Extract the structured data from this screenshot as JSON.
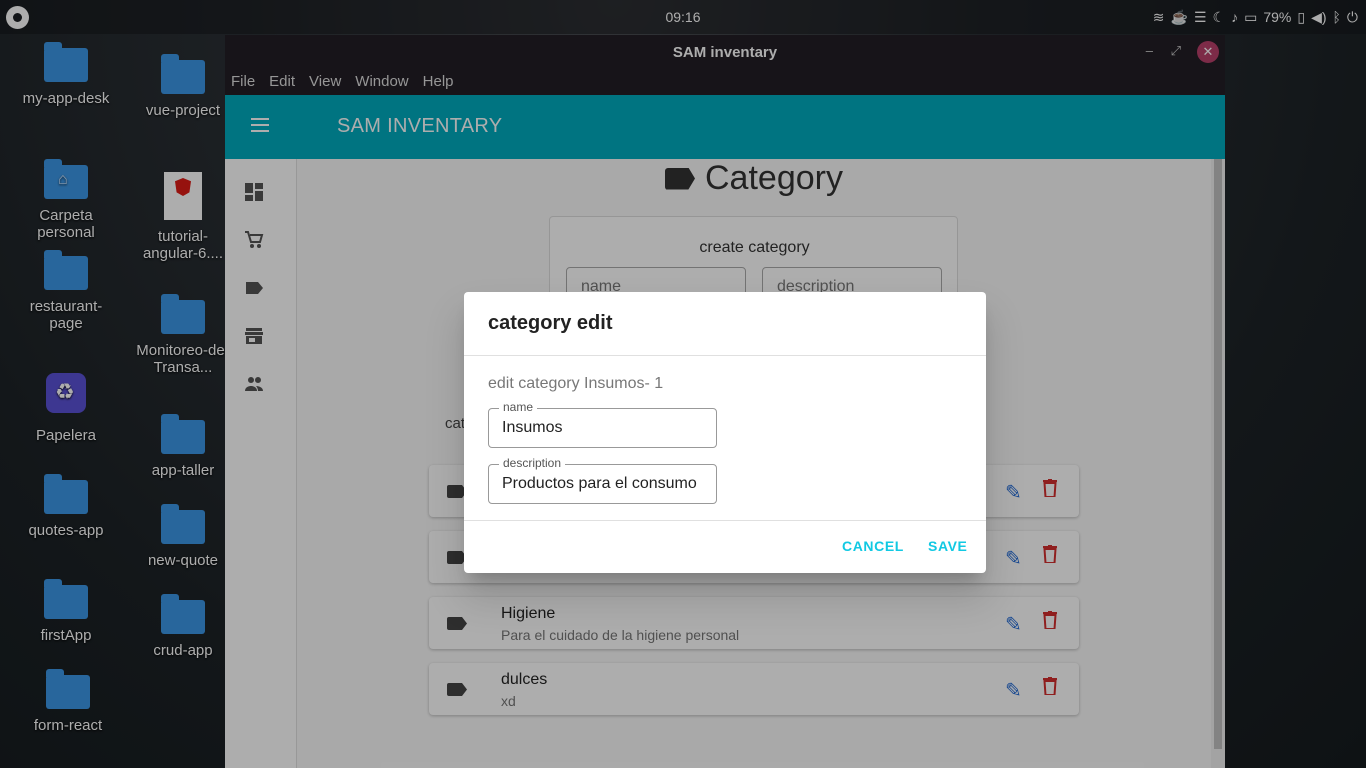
{
  "topbar": {
    "clock": "09:16",
    "battery_percent": "79%",
    "tray_icons": [
      "wifi-icon",
      "coffee-icon",
      "menu-icon",
      "moon-icon",
      "bell-icon",
      "folder-icon",
      "battery-icon",
      "volume-icon",
      "bluetooth-icon",
      "power-icon"
    ]
  },
  "desktop": {
    "icons": [
      {
        "label": "my-app-desk",
        "kind": "folder"
      },
      {
        "label": "vue-project",
        "kind": "folder"
      },
      {
        "label": "Carpeta personal",
        "kind": "home-folder"
      },
      {
        "label": "tutorial-angular-6....",
        "kind": "document"
      },
      {
        "label": "restaurant-page",
        "kind": "folder"
      },
      {
        "label": "Monitoreo-de-Transa...",
        "kind": "folder"
      },
      {
        "label": "Papelera",
        "kind": "trash"
      },
      {
        "label": "app-taller",
        "kind": "folder"
      },
      {
        "label": "quotes-app",
        "kind": "folder"
      },
      {
        "label": "new-quote",
        "kind": "folder"
      },
      {
        "label": "firstApp",
        "kind": "folder"
      },
      {
        "label": "crud-app",
        "kind": "folder"
      },
      {
        "label": "form-react",
        "kind": "folder"
      }
    ]
  },
  "window": {
    "title": "SAM inventary",
    "controls": [
      "minimize-icon",
      "maximize-icon",
      "close-icon"
    ],
    "menu": [
      "File",
      "Edit",
      "View",
      "Window",
      "Help"
    ]
  },
  "app": {
    "brand": "SAM INVENTARY",
    "accent_color": "#00abbf",
    "sidenav": [
      "dashboard-icon",
      "cart-icon",
      "label-icon",
      "store-icon",
      "people-icon"
    ],
    "page_title": "Category",
    "create_card": {
      "title": "create category",
      "name_placeholder": "name",
      "description_placeholder": "description"
    },
    "list_label_peek": "cat",
    "rows": [
      {
        "name": "",
        "description": ""
      },
      {
        "name": "",
        "description": ""
      },
      {
        "name": "Higiene",
        "description": "Para el cuidado de la higiene personal"
      },
      {
        "name": "dulces",
        "description": "xd"
      }
    ]
  },
  "dialog": {
    "title": "category edit",
    "subtitle": "edit category Insumos- 1",
    "name_label": "name",
    "name_value": "Insumos",
    "description_label": "description",
    "description_value": "Productos para el consumo",
    "cancel_label": "CANCEL",
    "save_label": "SAVE",
    "button_color": "#11c9e3"
  }
}
